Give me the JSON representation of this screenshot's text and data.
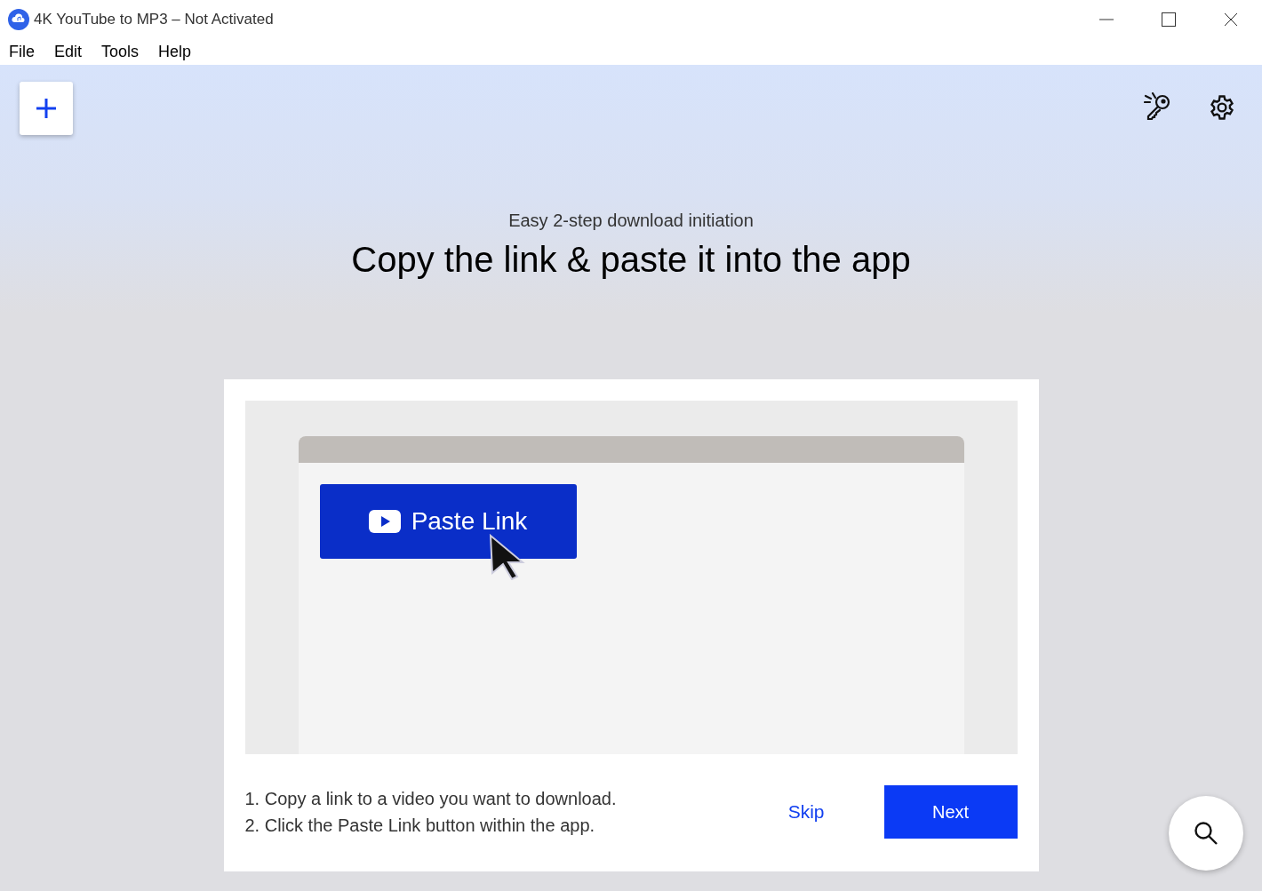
{
  "window": {
    "title": "4K YouTube to MP3 – Not Activated"
  },
  "menu": [
    "File",
    "Edit",
    "Tools",
    "Help"
  ],
  "intro": {
    "subtitle": "Easy 2-step download initiation",
    "heading": "Copy the link & paste it into the app"
  },
  "illustration": {
    "button_label": "Paste Link"
  },
  "steps": [
    "1. Copy a link to a video you want to download.",
    "2. Click the Paste Link button within the app."
  ],
  "buttons": {
    "skip": "Skip",
    "next": "Next"
  }
}
